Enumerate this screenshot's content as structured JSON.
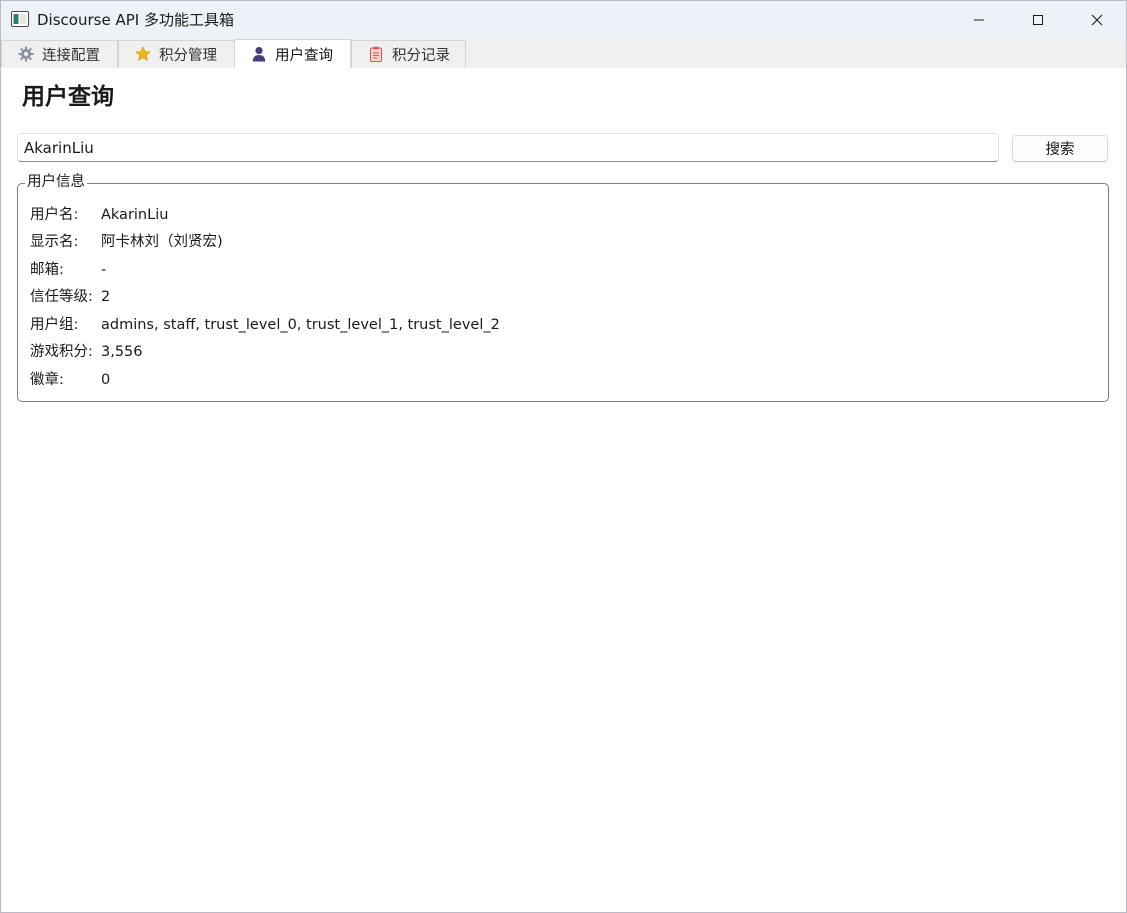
{
  "window": {
    "title": "Discourse API 多功能工具箱"
  },
  "tabs": [
    {
      "label": "连接配置",
      "icon": "gear-icon",
      "active": false
    },
    {
      "label": "积分管理",
      "icon": "star-icon",
      "active": false
    },
    {
      "label": "用户查询",
      "icon": "user-icon",
      "active": true
    },
    {
      "label": "积分记录",
      "icon": "clipboard-icon",
      "active": false
    }
  ],
  "page": {
    "title": "用户查询"
  },
  "search": {
    "value": "AkarinLiu",
    "button_label": "搜索"
  },
  "user_info": {
    "group_title": "用户信息",
    "rows": [
      {
        "label": "用户名:",
        "value": "AkarinLiu"
      },
      {
        "label": "显示名:",
        "value": "阿卡林刘（刘贤宏)"
      },
      {
        "label": "邮箱:",
        "value": "-"
      },
      {
        "label": "信任等级:",
        "value": "2"
      },
      {
        "label": "用户组:",
        "value": "admins, staff, trust_level_0, trust_level_1, trust_level_2"
      },
      {
        "label": "游戏积分:",
        "value": "3,556"
      },
      {
        "label": "徽章:",
        "value": "0"
      }
    ]
  },
  "colors": {
    "titlebar_bg": "#eef1f8",
    "tabstrip_bg": "#f0f0f0",
    "star": "#f2b418",
    "user": "#4b3a78",
    "clipboard": "#d9534f"
  }
}
